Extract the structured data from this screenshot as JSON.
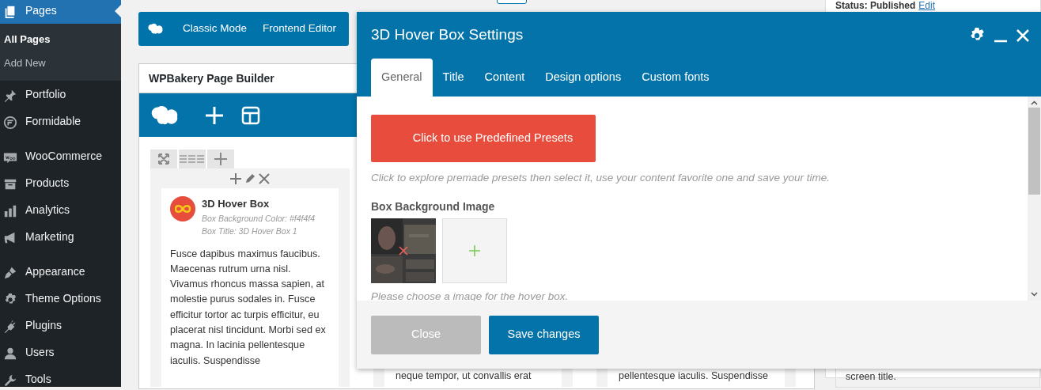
{
  "sidebar": {
    "groups": [
      {
        "items": [
          {
            "label": "Pages",
            "selected": true,
            "children": [
              {
                "label": "All Pages",
                "selected": true
              },
              {
                "label": "Add New",
                "selected": false
              }
            ]
          },
          {
            "label": "Portfolio",
            "selected": false
          },
          {
            "label": "Formidable",
            "selected": false
          }
        ]
      },
      {
        "items": [
          {
            "label": "WooCommerce",
            "selected": false
          },
          {
            "label": "Products",
            "selected": false
          },
          {
            "label": "Analytics",
            "selected": false
          },
          {
            "label": "Marketing",
            "selected": false
          }
        ]
      },
      {
        "items": [
          {
            "label": "Appearance",
            "selected": false
          },
          {
            "label": "Theme Options",
            "selected": false
          },
          {
            "label": "Plugins",
            "selected": false
          },
          {
            "label": "Users",
            "selected": false
          },
          {
            "label": "Tools",
            "selected": false
          }
        ]
      }
    ]
  },
  "builder": {
    "mode_buttons": [
      "Classic Mode",
      "Frontend Editor"
    ],
    "panel_title": "WPBakery Page Builder",
    "element": {
      "title": "3D Hover Box",
      "info": "Box Background Color: #f4f4f4  Box Title: 3D Hover Box 1",
      "text": "Fusce dapibus maximus faucibus. Maecenas rutrum urna nisl. Vivamus rhoncus massa sapien, at molestie purus sodales in. Fusce efficitur tortor ac turpis efficitur, eu placerat nisl tincidunt. Morbi sed ex magna. In lacinia pellentesque iaculis. Suspendisse"
    },
    "column_texts": [
      "neque tempor, ut convallis erat",
      "pellentesque iaculis. Suspendisse"
    ]
  },
  "publish": {
    "status": "Status: Published",
    "edit_link": "Edit"
  },
  "side_box": {
    "text": "screen title."
  },
  "modal": {
    "title": "3D Hover Box Settings",
    "tabs": [
      {
        "label": "General",
        "selected": true
      },
      {
        "label": "Title",
        "selected": false
      },
      {
        "label": "Content",
        "selected": false
      },
      {
        "label": "Design options",
        "selected": false
      },
      {
        "label": "Custom fonts",
        "selected": false
      }
    ],
    "presets_button": "Click to use Predefined Presets",
    "presets_help": "Click to explore premade presets then select it, use your content favorite one and save your time.",
    "image_label": "Box Background Image",
    "image_help": "Please choose a image for the hover box.",
    "buttons": [
      {
        "label": "Close",
        "kind": "secondary"
      },
      {
        "label": "Save changes",
        "kind": "primary"
      }
    ]
  }
}
